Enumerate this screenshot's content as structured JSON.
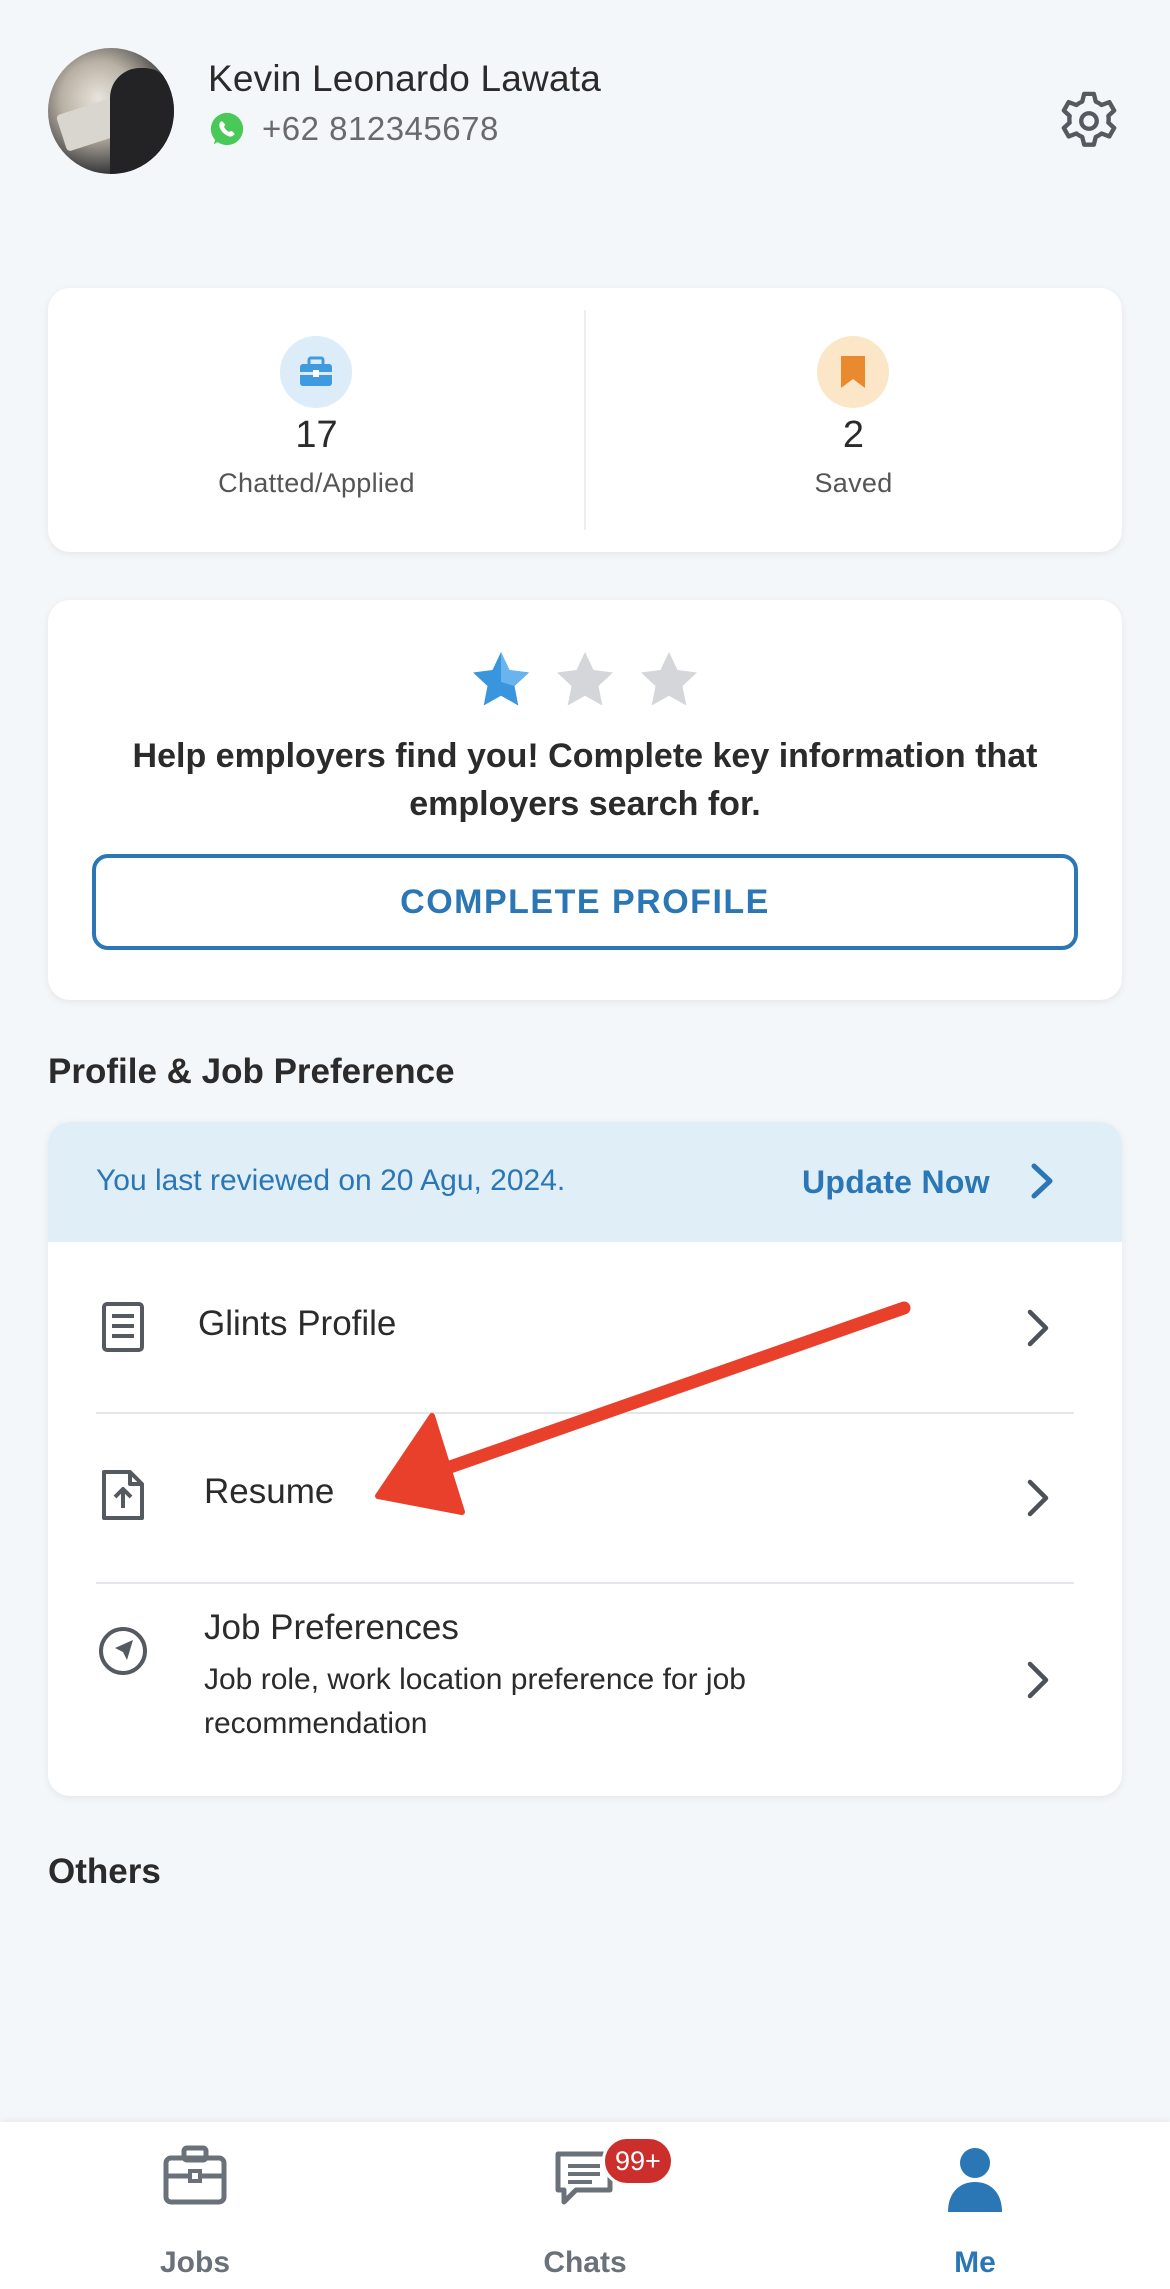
{
  "user": {
    "name": "Kevin Leonardo Lawata",
    "phone": "+62 812345678"
  },
  "stats": [
    {
      "value": "17",
      "label": "Chatted/Applied",
      "icon": "briefcase-icon"
    },
    {
      "value": "2",
      "label": "Saved",
      "icon": "bookmark-icon"
    }
  ],
  "profile_strength": {
    "stars_filled": 1,
    "stars_total": 3,
    "message": "Help employers find you! Complete key information that employers search for.",
    "button_label": "COMPLETE PROFILE"
  },
  "sections": {
    "profile_pref_title": "Profile & Job Preference",
    "others_title": "Others"
  },
  "review": {
    "text": "You last reviewed on 20 Agu, 2024.",
    "action_label": "Update Now"
  },
  "profile_items": [
    {
      "title": "Glints Profile",
      "icon": "document-icon"
    },
    {
      "title": "Resume",
      "icon": "file-upload-icon"
    },
    {
      "title": "Job Preferences",
      "subtitle": "Job role, work location preference for job recommendation",
      "icon": "compass-icon"
    }
  ],
  "nav": {
    "items": [
      {
        "label": "Jobs",
        "icon": "briefcase-icon",
        "active": false
      },
      {
        "label": "Chats",
        "icon": "chat-icon",
        "active": false,
        "badge": "99+"
      },
      {
        "label": "Me",
        "icon": "person-icon",
        "active": true
      }
    ]
  },
  "colors": {
    "accent": "#2b77b5",
    "background": "#f4f7fa",
    "review_bar": "#e0eef7",
    "badge": "#cc2f2b",
    "annotation_arrow": "#e8402a"
  }
}
